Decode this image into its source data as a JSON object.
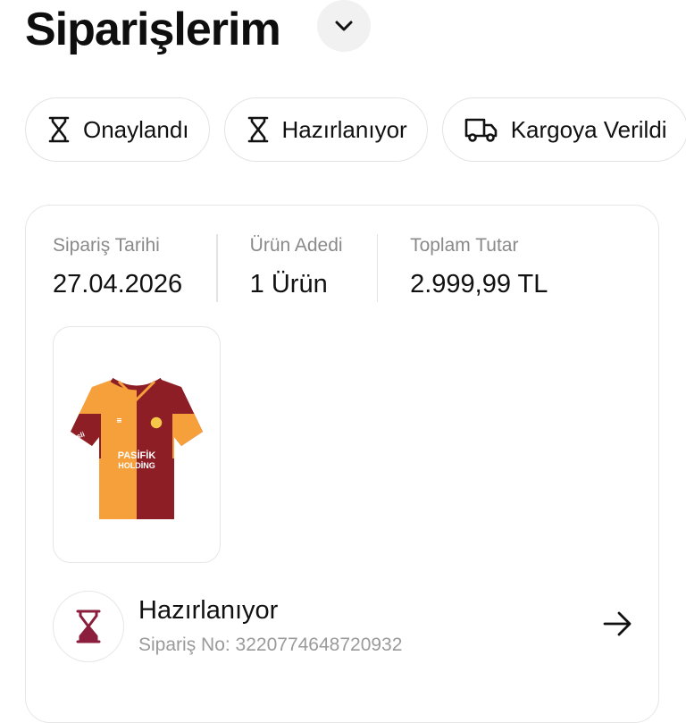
{
  "header": {
    "title": "Siparişlerim",
    "dropdown_icon": "chevron-down-icon"
  },
  "filters": [
    {
      "label": "Onaylandı",
      "icon": "hourglass-icon"
    },
    {
      "label": "Hazırlanıyor",
      "icon": "hourglass-icon"
    },
    {
      "label": "Kargoya Verildi",
      "icon": "truck-icon"
    }
  ],
  "order": {
    "meta": {
      "date_label": "Sipariş Tarihi",
      "date_value": "27.04.2026",
      "qty_label": "Ürün Adedi",
      "qty_value": "1 Ürün",
      "total_label": "Toplam Tutar",
      "total_value": "2.999,99 TL"
    },
    "product": {
      "sponsor_line1": "PASİFİK",
      "sponsor_line2": "HOLDİNG",
      "sleeve_text": "sli"
    },
    "status": {
      "title": "Hazırlanıyor",
      "order_no_label": "Sipariş No:",
      "order_no": "3220774648720932",
      "icon": "hourglass-icon"
    }
  },
  "colors": {
    "accent": "#8a1e3c",
    "jersey_orange": "#f5a03a",
    "jersey_red": "#8e1e26"
  }
}
